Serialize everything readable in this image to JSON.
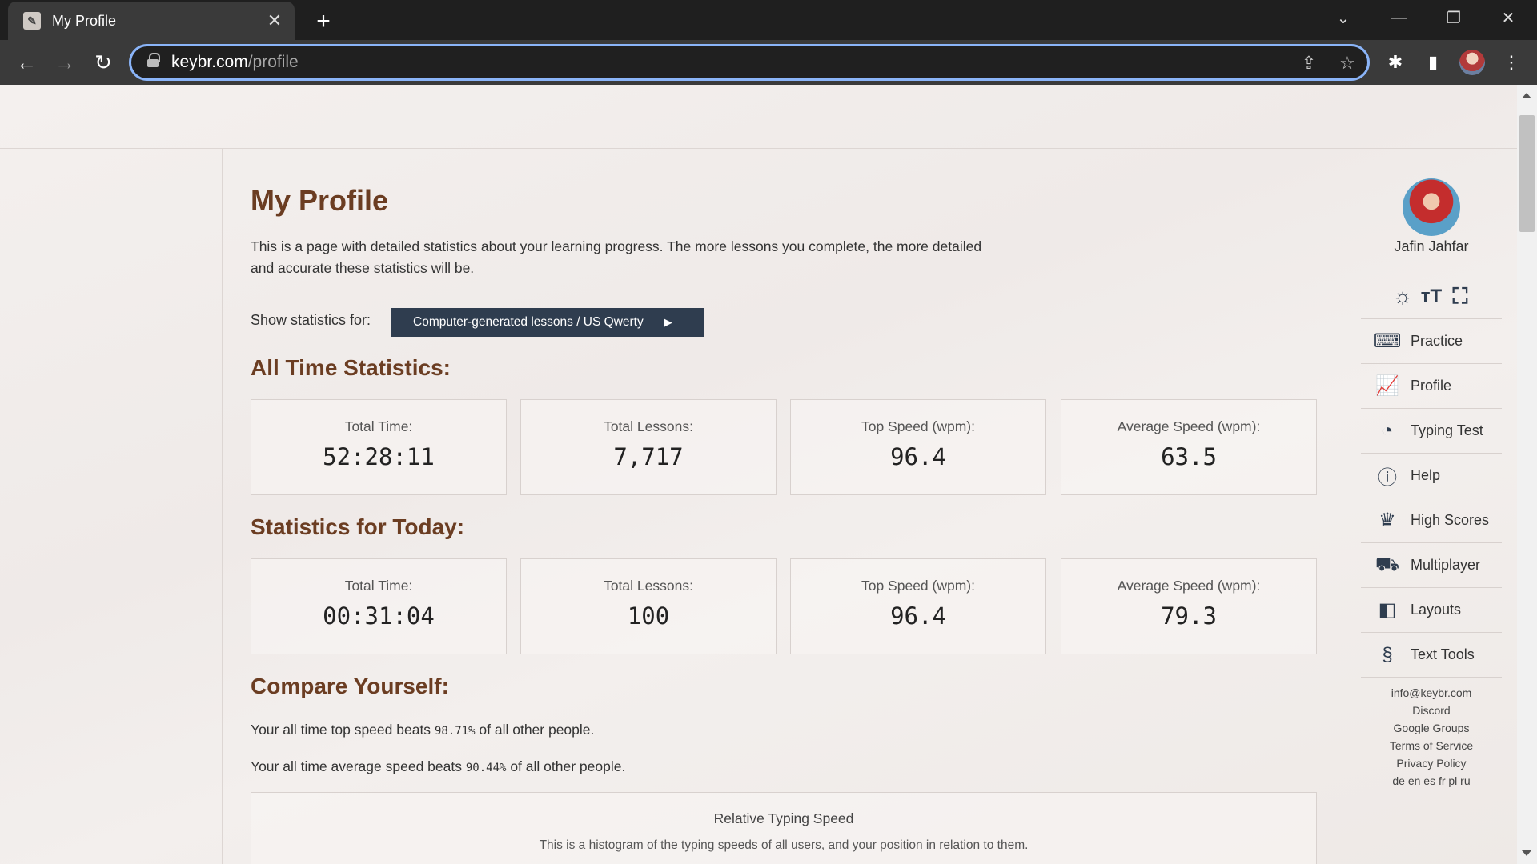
{
  "browser": {
    "tab_title": "My Profile",
    "tab_close": "✕",
    "new_tab": "+",
    "url_host": "keybr.com",
    "url_path": "/profile"
  },
  "page": {
    "title": "My Profile",
    "intro": "This is a page with detailed statistics about your learning progress. The more lessons you complete, the more detailed and accurate these statistics will be.",
    "filter_label": "Show statistics for:",
    "filter_value": "Computer-generated lessons / US Qwerty",
    "filter_arrow": "▶"
  },
  "all_time": {
    "title": "All Time Statistics:",
    "stats": [
      {
        "label": "Total Time:",
        "value": "52:28:11"
      },
      {
        "label": "Total Lessons:",
        "value": "7,717"
      },
      {
        "label": "Top Speed (wpm):",
        "value": "96.4"
      },
      {
        "label": "Average Speed (wpm):",
        "value": "63.5"
      }
    ]
  },
  "today": {
    "title": "Statistics for Today:",
    "stats": [
      {
        "label": "Total Time:",
        "value": "00:31:04"
      },
      {
        "label": "Total Lessons:",
        "value": "100"
      },
      {
        "label": "Top Speed (wpm):",
        "value": "96.4"
      },
      {
        "label": "Average Speed (wpm):",
        "value": "79.3"
      }
    ]
  },
  "compare": {
    "title": "Compare Yourself:",
    "top_prefix": "Your all time top speed beats",
    "top_pct": "98.71%",
    "top_suffix": "of all other people.",
    "avg_prefix": "Your all time average speed beats",
    "avg_pct": "90.44%",
    "avg_suffix": "of all other people."
  },
  "histogram": {
    "title": "Relative Typing Speed",
    "description": "This is a histogram of the typing speeds of all users, and your position in relation to them."
  },
  "sidebar": {
    "username": "Jafin Jahfar",
    "menu": [
      {
        "label": "Practice",
        "icon": "keyboard-icon"
      },
      {
        "label": "Profile",
        "icon": "chart-icon"
      },
      {
        "label": "Typing Test",
        "icon": "speedometer-icon"
      },
      {
        "label": "Help",
        "icon": "help-icon"
      },
      {
        "label": "High Scores",
        "icon": "trophy-icon"
      },
      {
        "label": "Multiplayer",
        "icon": "car-icon"
      },
      {
        "label": "Layouts",
        "icon": "layouts-icon"
      },
      {
        "label": "Text Tools",
        "icon": "section-icon"
      }
    ],
    "footer": {
      "email": "info@keybr.com",
      "discord": "Discord",
      "groups": "Google Groups",
      "terms": "Terms of Service",
      "privacy": "Privacy Policy",
      "languages": "de en es fr pl ru"
    }
  }
}
